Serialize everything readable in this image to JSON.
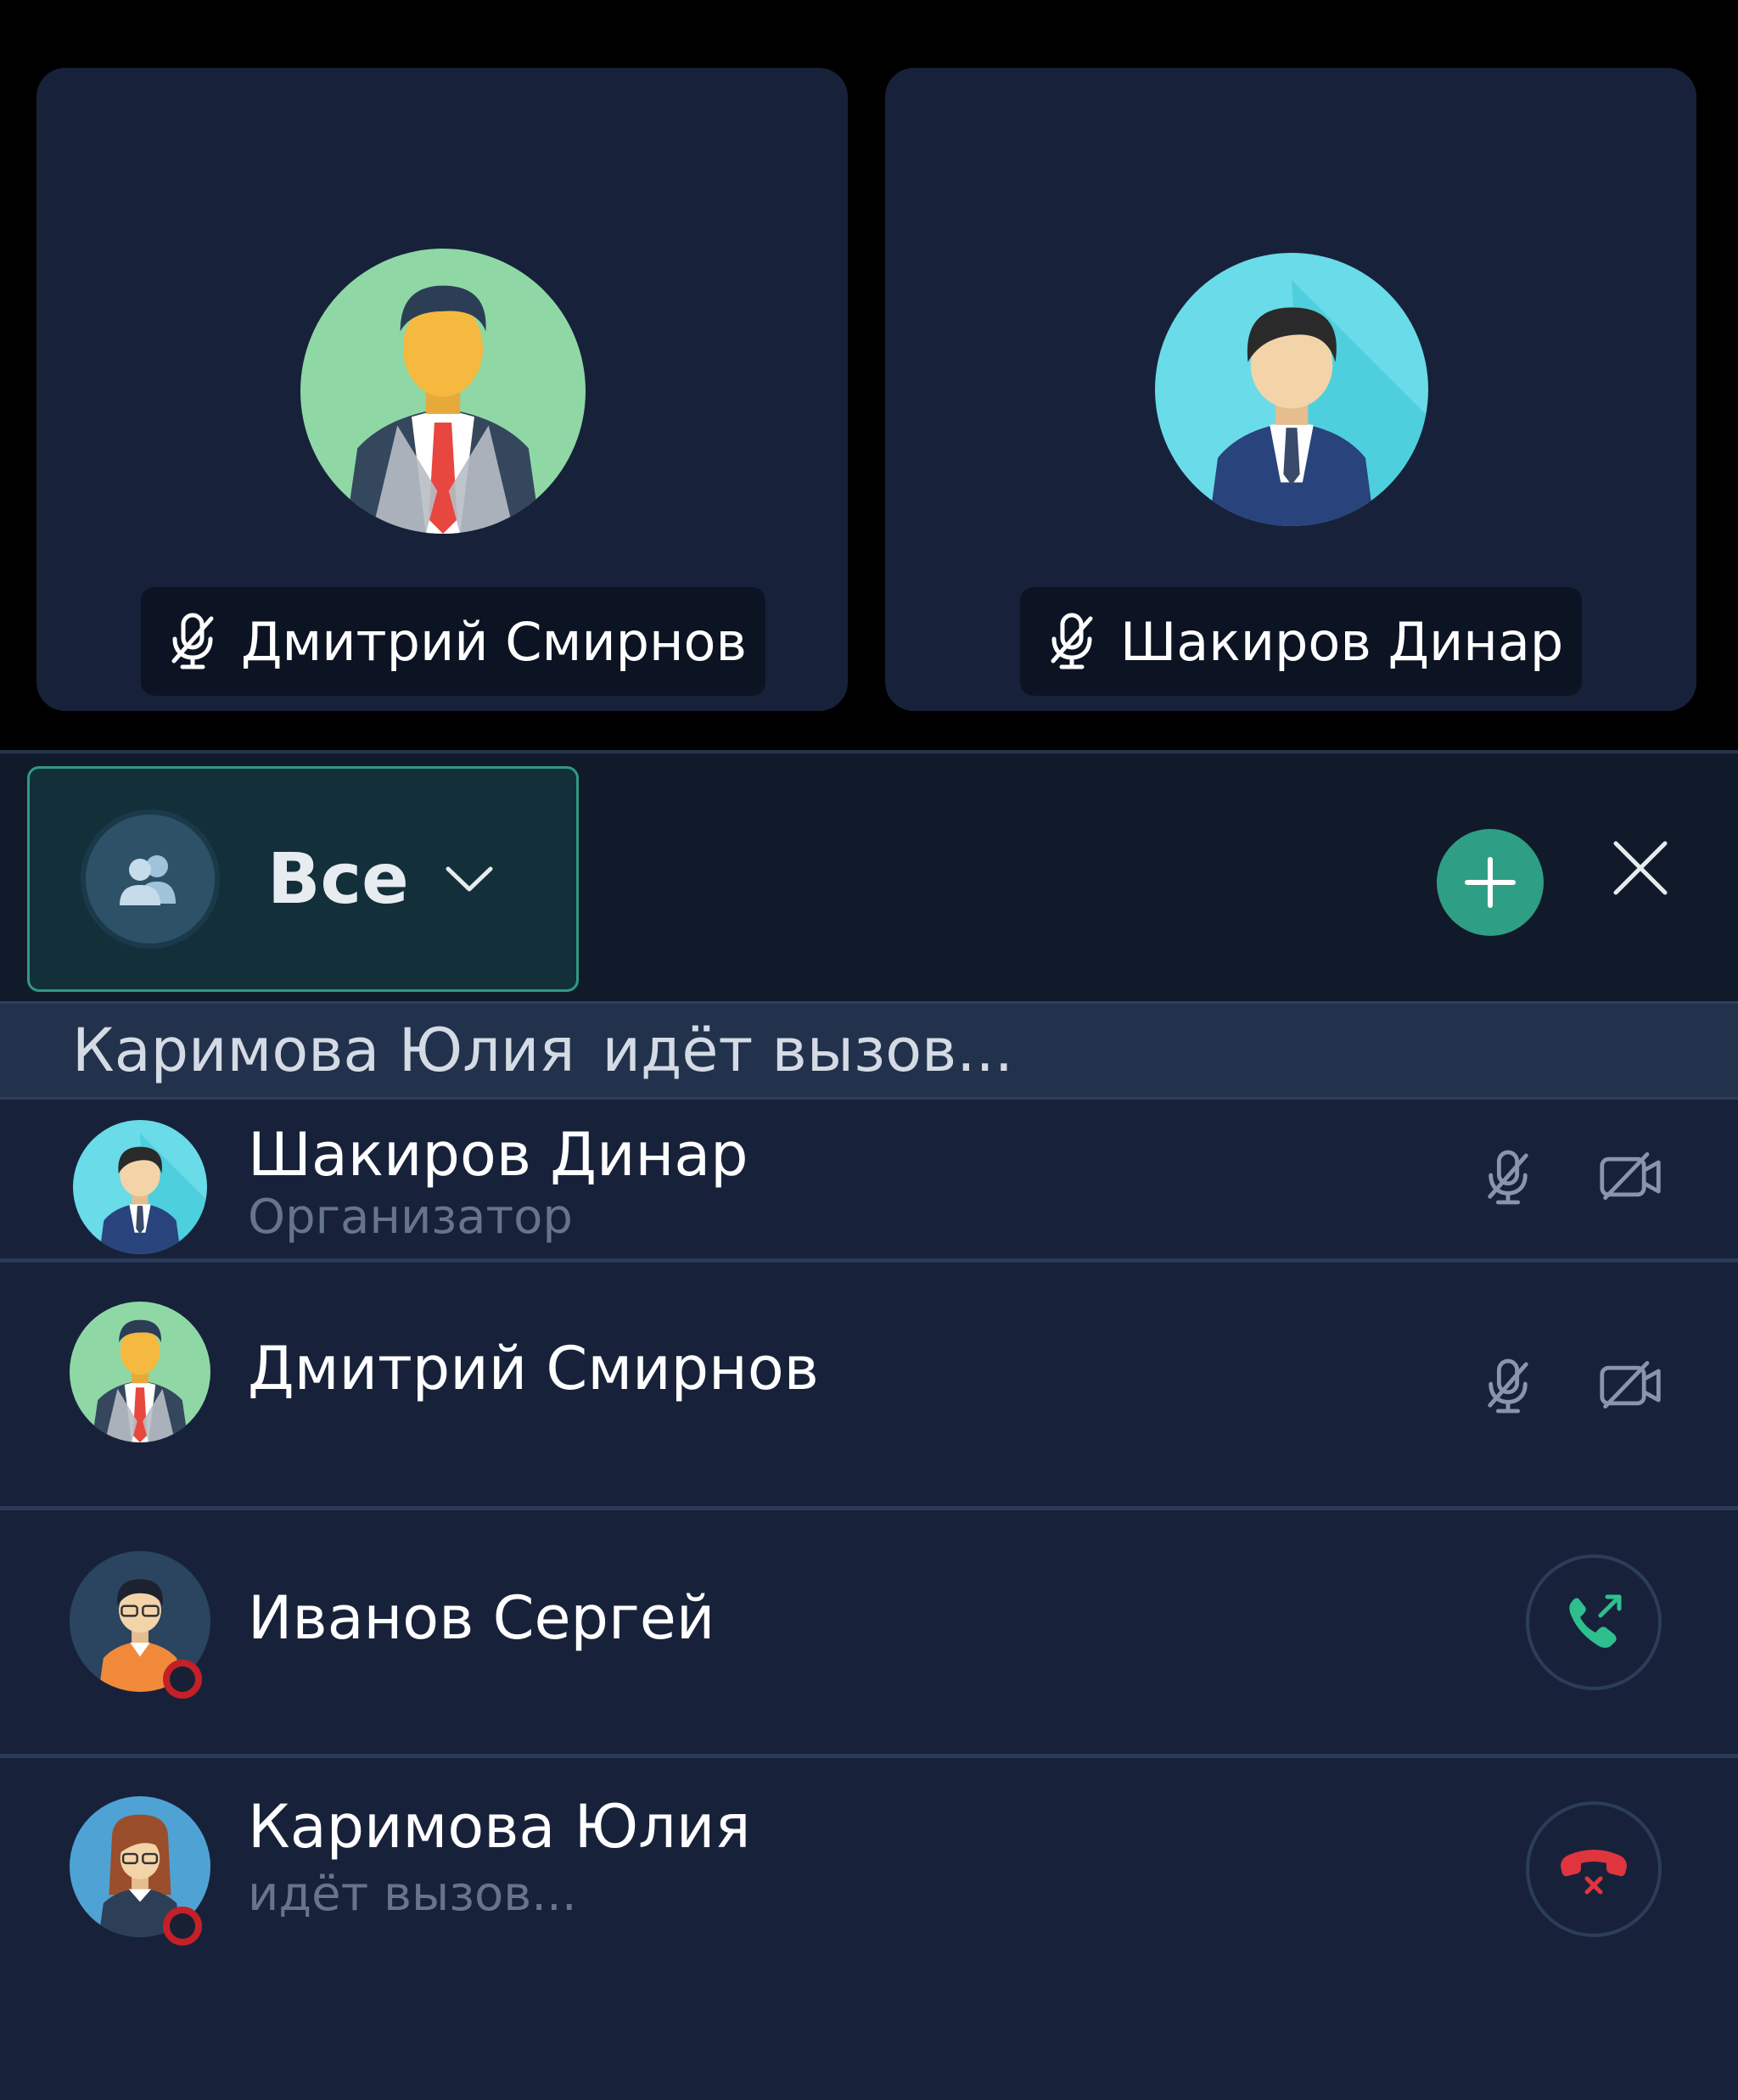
{
  "tiles": [
    {
      "name": "Дмитрий Смирнов",
      "mic_icon": "mic-off-icon"
    },
    {
      "name": "Шакиров Динар",
      "mic_icon": "mic-off-icon"
    }
  ],
  "filter": {
    "label": "Все",
    "icon": "users-icon"
  },
  "header_actions": {
    "add": "plus-icon",
    "close": "close-icon"
  },
  "calling_banner": {
    "name": "Каримова Юлия",
    "status": "идёт вызов..."
  },
  "participants": [
    {
      "name": "Шакиров Динар",
      "subtitle": "Организатор",
      "mic": "muted",
      "camera": "off"
    },
    {
      "name": "Дмитрий Смирнов",
      "subtitle": "",
      "mic": "muted",
      "camera": "off"
    },
    {
      "name": "Иванов Сергей",
      "subtitle": "",
      "action": "call-icon",
      "status": "offline"
    },
    {
      "name": "Каримова Юлия",
      "subtitle": "идёт вызов...",
      "action": "hang-up-icon",
      "status": "offline"
    }
  ],
  "colors": {
    "background": "#000000",
    "tile": "#17223a",
    "accent": "#2e9e85",
    "offline": "#c42027",
    "hangup": "#e0353e"
  }
}
